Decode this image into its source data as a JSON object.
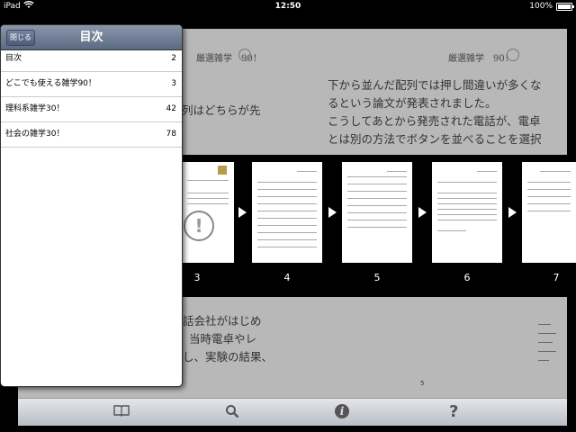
{
  "status_bar": {
    "carrier": "iPad",
    "time": "12:50",
    "battery": "100%",
    "battery_level": 1.0
  },
  "page": {
    "left_header": "厳選雑学　90！",
    "right_header": "厳選雑学　90！",
    "left_top_text": "列はどちらが先",
    "right_top_lines": [
      "下から並んだ配列では押し間違いが多くな",
      "るという論文が発表されました。",
      "こうしてあとから発売された電話が、電卓",
      "とは別の方法でボタンを並べることを選択"
    ],
    "left_bottom_lines": [
      "話会社がはじめ",
      "当時電卓やレ",
      "し、実験の結果、"
    ],
    "page_number": "5"
  },
  "thumbnails": [
    {
      "number": "3"
    },
    {
      "number": "4"
    },
    {
      "number": "5"
    },
    {
      "number": "6"
    },
    {
      "number": "7"
    }
  ],
  "toc": {
    "title": "目次",
    "close_label": "閉じる",
    "items": [
      {
        "label": "目次",
        "page": "2"
      },
      {
        "label": "どこでも使える雑学90！",
        "page": "3"
      },
      {
        "label": "理科系雑学30！",
        "page": "42"
      },
      {
        "label": "社会の雑学30！",
        "page": "78"
      }
    ]
  },
  "toolbar": {
    "icons": [
      "book-icon",
      "search-icon",
      "info-icon",
      "help-icon"
    ],
    "info_glyph": "i",
    "help_glyph": "?"
  }
}
